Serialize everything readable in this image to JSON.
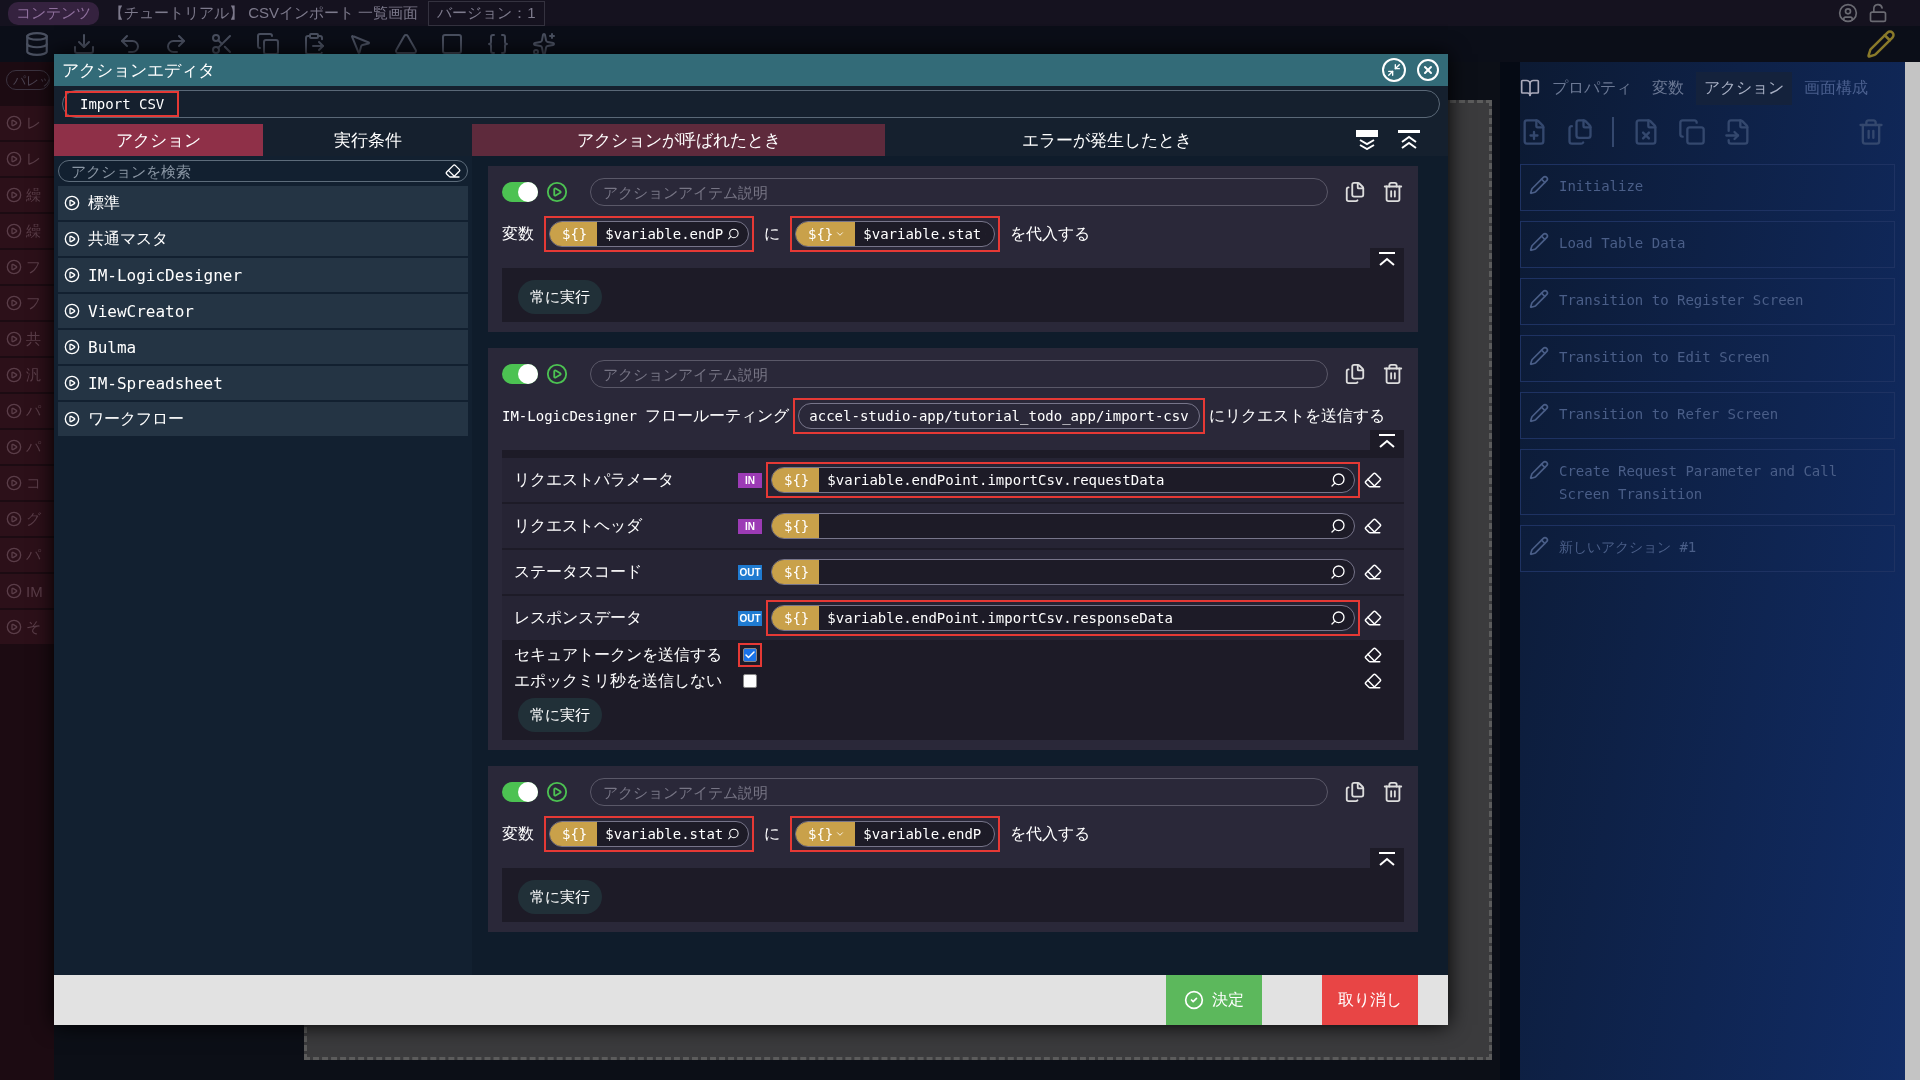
{
  "topbar": {
    "tag": "コンテンツ",
    "title": "【チュートリアル】 CSVインポート 一覧画面",
    "version": "バージョン：1"
  },
  "palette": {
    "search": "パレッ",
    "items": [
      "レ",
      "レ",
      "繰",
      "繰",
      "フ",
      "フ",
      "共",
      "汎",
      "パ",
      "パ",
      "コ",
      "グ",
      "パ",
      "IM",
      "そ"
    ]
  },
  "modal": {
    "title": "アクションエディタ",
    "name": {
      "value": "Import CSV",
      "highlighted": true
    },
    "left_tabs": [
      {
        "label": "アクション",
        "selected": true
      },
      {
        "label": "実行条件",
        "selected": false
      }
    ],
    "search_placeholder": "アクションを検索",
    "categories": [
      "標準",
      "共通マスタ",
      "IM-LogicDesigner",
      "ViewCreator",
      "Bulma",
      "IM-Spreadsheet",
      "ワークフロー"
    ],
    "event_tabs": [
      {
        "label": "アクションが呼ばれたとき",
        "selected": true
      },
      {
        "label": "エラーが発生したとき",
        "selected": false
      }
    ],
    "actions": [
      {
        "kind": "assign",
        "enabled": true,
        "placeholder": "アクションアイテム説明",
        "prefix": "変数",
        "target": {
          "token": "${}",
          "value": "$variable.endP",
          "highlighted": true
        },
        "joiner": "に",
        "source": {
          "token": "${}",
          "dropdown": true,
          "value": "$variable.stat",
          "highlighted": true
        },
        "suffix": "を代入する",
        "condition": "常に実行"
      },
      {
        "kind": "request",
        "enabled": true,
        "placeholder": "アクションアイテム説明",
        "source": "IM-LogicDesigner",
        "prefix": "フロールーティング",
        "route": {
          "value": "accel-studio-app/tutorial_todo_app/import-csv",
          "highlighted": true
        },
        "suffix": "にリクエストを送信する",
        "params": [
          {
            "kind": "field",
            "label": "リクエストパラメータ",
            "color": "#9c3bb5",
            "badge": "IN",
            "token": "${}",
            "value": "$variable.endPoint.importCsv.requestData",
            "highlighted": true
          },
          {
            "kind": "field",
            "label": "リクエストヘッダ",
            "color": "#9c3bb5",
            "badge": "IN",
            "token": "${}",
            "highlighted": false
          },
          {
            "kind": "field",
            "label": "ステータスコード",
            "color": "#1f7bd1",
            "badge": "OUT",
            "token": "${}",
            "highlighted": false
          },
          {
            "kind": "field",
            "label": "レスポンスデータ",
            "color": "#1f7bd1",
            "badge": "OUT",
            "token": "${}",
            "value": "$variable.endPoint.importCsv.responseData",
            "highlighted": true
          },
          {
            "kind": "checkbox",
            "label": "セキュアトークンを送信する",
            "checked": true,
            "highlighted": true
          },
          {
            "kind": "checkbox",
            "label": "エポックミリ秒を送信しない",
            "checked": false,
            "highlighted": false
          }
        ],
        "condition": "常に実行"
      },
      {
        "kind": "assign",
        "enabled": true,
        "placeholder": "アクションアイテム説明",
        "prefix": "変数",
        "target": {
          "token": "${}",
          "value": "$variable.stat",
          "highlighted": true
        },
        "joiner": "に",
        "source": {
          "token": "${}",
          "dropdown": true,
          "value": "$variable.endP",
          "highlighted": true
        },
        "suffix": "を代入する",
        "condition": "常に実行"
      }
    ],
    "buttons": [
      {
        "kind": "confirm",
        "label": "決定"
      },
      {
        "kind": "cancel",
        "label": "取り消し"
      }
    ]
  },
  "right_panel": {
    "tabs": [
      {
        "label": "プロパティ",
        "selected": false,
        "disabled": false
      },
      {
        "label": "変数",
        "selected": false,
        "disabled": false
      },
      {
        "label": "アクション",
        "selected": true,
        "disabled": false
      },
      {
        "label": "画面構成",
        "selected": false,
        "disabled": true
      }
    ],
    "actions": [
      "Initialize",
      "Load Table Data",
      "Transition to Register Screen",
      "Transition to Edit Screen",
      "Transition to Refer Screen",
      "Create Request Parameter and Call Screen Transition",
      "新しいアクション #1"
    ]
  }
}
